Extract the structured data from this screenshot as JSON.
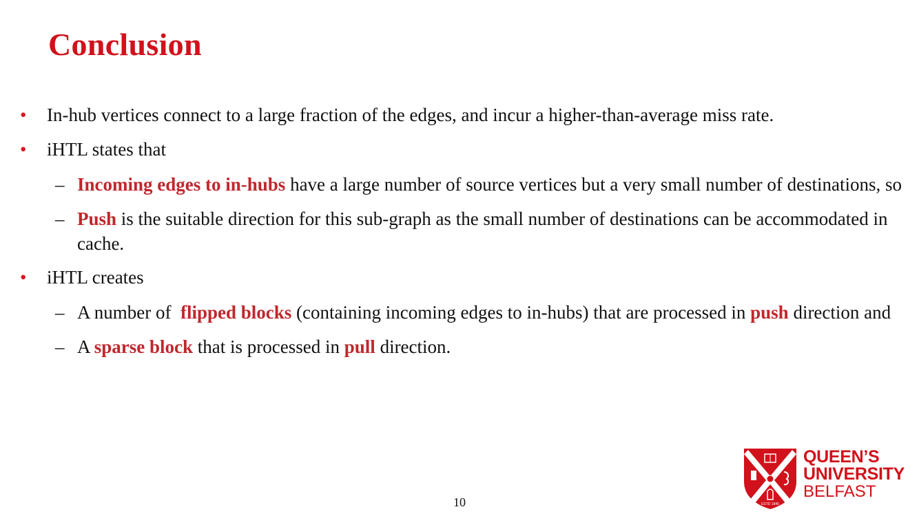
{
  "slide": {
    "title": "Conclusion",
    "page_number": "10",
    "accent_color": "#d1111b",
    "highlight_color": "#c0272d"
  },
  "bullets": [
    {
      "text": "In-hub vertices connect to a large fraction of the edges, and incur a higher-than-average miss rate."
    },
    {
      "text": "iHTL states that",
      "sub": [
        {
          "hl": "Incoming edges to in-hubs",
          "rest": " have a large number of source vertices but a very small number of destinations, so"
        },
        {
          "hl": "Push",
          "rest": " is the suitable direction for this sub-graph as the small number of destinations can be accommodated in cache."
        }
      ]
    },
    {
      "text": "iHTL creates",
      "sub": [
        {
          "pre": "A number of  ",
          "hl1": "flipped blocks",
          "mid": " (containing incoming edges to in-hubs) that are processed in ",
          "hl2": "push",
          "post": " direction and"
        },
        {
          "pre": "A ",
          "hl1": "sparse block",
          "mid": " that is processed in ",
          "hl2": "pull",
          "post": " direction."
        }
      ]
    }
  ],
  "logo": {
    "line1": "QUEEN’S",
    "line2": "UNIVERSITY",
    "line3": "BELFAST",
    "crest_text": "ESTD 1845",
    "icon": "university-crest-icon"
  },
  "symbols": {
    "bullet": "•",
    "dash": "–"
  }
}
